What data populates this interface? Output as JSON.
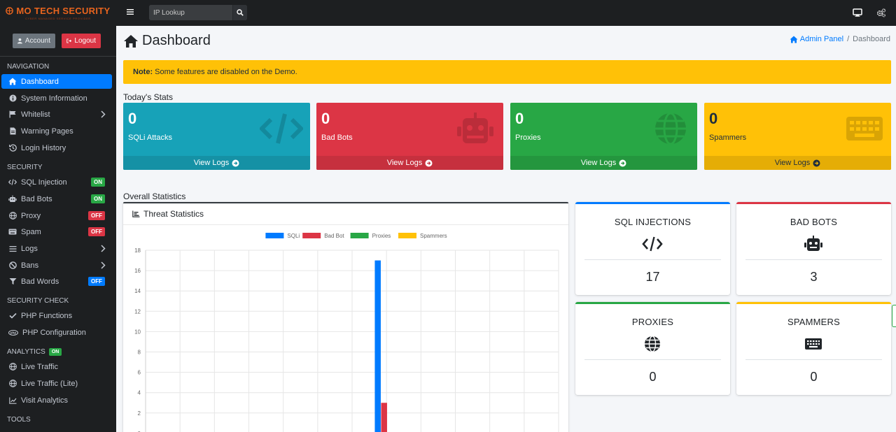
{
  "brand": {
    "name": "MO TECH SECURITY",
    "tagline": "CYBER MANAGED SERVICE PROVIDER"
  },
  "topbar": {
    "search_placeholder": "IP Lookup"
  },
  "user": {
    "account_label": "Account",
    "logout_label": "Logout"
  },
  "sidebar": {
    "navigation_header": "NAVIGATION",
    "nav": [
      {
        "label": "Dashboard",
        "icon": "home-icon",
        "active": true
      },
      {
        "label": "System Information",
        "icon": "info-icon"
      },
      {
        "label": "Whitelist",
        "icon": "flag-icon",
        "expandable": true
      },
      {
        "label": "Warning Pages",
        "icon": "file-icon"
      },
      {
        "label": "Login History",
        "icon": "history-icon"
      }
    ],
    "security_header": "SECURITY",
    "security": [
      {
        "label": "SQL Injection",
        "icon": "code-icon",
        "badge": "ON"
      },
      {
        "label": "Bad Bots",
        "icon": "robot-icon",
        "badge": "ON"
      },
      {
        "label": "Proxy",
        "icon": "globe-icon",
        "badge": "OFF"
      },
      {
        "label": "Spam",
        "icon": "keyboard-icon",
        "badge": "OFF"
      },
      {
        "label": "Logs",
        "icon": "list-icon",
        "expandable": true
      },
      {
        "label": "Bans",
        "icon": "ban-icon",
        "expandable": true
      },
      {
        "label": "Bad Words",
        "icon": "filter-icon",
        "badge": "OFF"
      }
    ],
    "security_check_header": "SECURITY CHECK",
    "security_check": [
      {
        "label": "PHP Functions",
        "icon": "check-icon"
      },
      {
        "label": "PHP Configuration",
        "icon": "php-icon"
      }
    ],
    "analytics_header": "ANALYTICS",
    "analytics_badge": "ON",
    "analytics": [
      {
        "label": "Live Traffic",
        "icon": "globe-icon"
      },
      {
        "label": "Live Traffic (Lite)",
        "icon": "globe-icon"
      },
      {
        "label": "Visit Analytics",
        "icon": "chart-line-icon"
      }
    ],
    "tools_header": "TOOLS"
  },
  "page": {
    "title": "Dashboard",
    "breadcrumb": {
      "root": "Admin Panel",
      "current": "Dashboard"
    },
    "alert": {
      "bold": "Note:",
      "text": "Some features are disabled on the Demo."
    },
    "todays_stats_title": "Today's Stats",
    "overall_stats_title": "Overall Statistics"
  },
  "stat_boxes": [
    {
      "value": "0",
      "label": "SQLi Attacks",
      "footer": "View Logs",
      "icon": "code-icon",
      "color": "#17a2b8"
    },
    {
      "value": "0",
      "label": "Bad Bots",
      "footer": "View Logs",
      "icon": "robot-icon",
      "color": "#dc3545"
    },
    {
      "value": "0",
      "label": "Proxies",
      "footer": "View Logs",
      "icon": "globe-icon",
      "color": "#28a745"
    },
    {
      "value": "0",
      "label": "Spammers",
      "footer": "View Logs",
      "icon": "keyboard-icon",
      "color": "#ffc107"
    }
  ],
  "summary": [
    {
      "title": "SQL INJECTIONS",
      "value": "17",
      "icon": "code-icon",
      "color": "#007bff"
    },
    {
      "title": "BAD BOTS",
      "value": "3",
      "icon": "robot-icon",
      "color": "#dc3545"
    },
    {
      "title": "PROXIES",
      "value": "0",
      "icon": "globe-icon",
      "color": "#28a745"
    },
    {
      "title": "SPAMMERS",
      "value": "0",
      "icon": "keyboard-icon",
      "color": "#ffc107"
    }
  ],
  "chart_title": "Threat Statistics",
  "chart_data": {
    "type": "bar",
    "title": "",
    "legend_position": "top",
    "grid": true,
    "ylim": [
      0,
      18
    ],
    "yticks": [
      2,
      4,
      6,
      8,
      10,
      12,
      14,
      16,
      18
    ],
    "categories": [
      "",
      "",
      "",
      "",
      "",
      "",
      "",
      "",
      "",
      "",
      "",
      ""
    ],
    "series": [
      {
        "name": "SQLi",
        "color": "#007bff",
        "values": [
          0,
          0,
          0,
          0,
          0,
          0,
          17,
          0,
          0,
          0,
          0,
          0
        ]
      },
      {
        "name": "Bad Bot",
        "color": "#dc3545",
        "values": [
          0,
          0,
          0,
          0,
          0,
          0,
          3,
          0,
          0,
          0,
          0,
          0
        ]
      },
      {
        "name": "Proxies",
        "color": "#28a745",
        "values": [
          0,
          0,
          0,
          0,
          0,
          0,
          0,
          0,
          0,
          0,
          0,
          0
        ]
      },
      {
        "name": "Spammers",
        "color": "#ffc107",
        "values": [
          0,
          0,
          0,
          0,
          0,
          0,
          0,
          0,
          0,
          0,
          0,
          0
        ]
      }
    ]
  }
}
